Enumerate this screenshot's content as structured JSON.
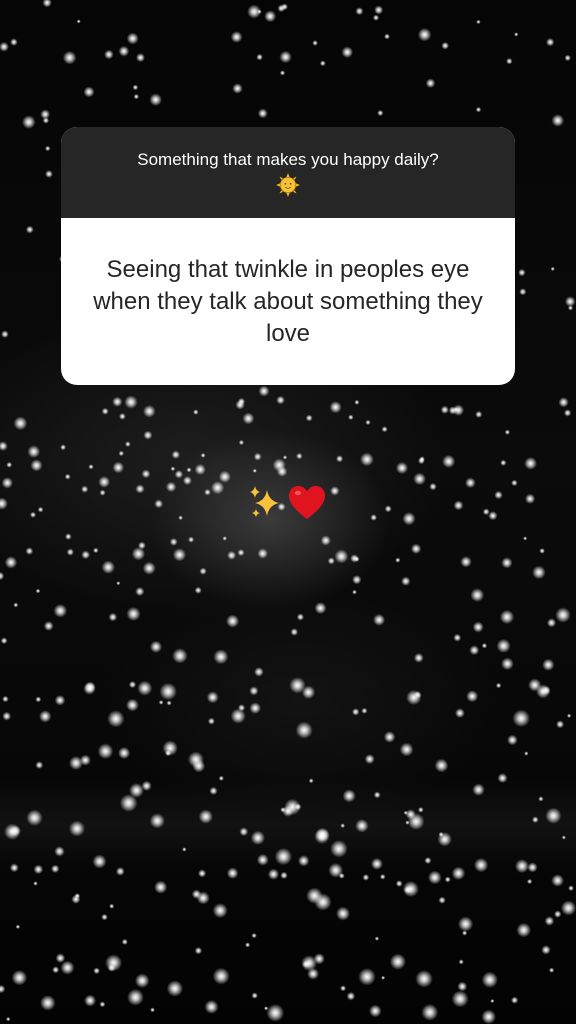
{
  "story": {
    "question": "Something that makes you happy daily?",
    "question_emoji": "sun-with-face-icon",
    "answer": "Seeing that twinkle in peoples eye when they talk about something they love",
    "sticker": [
      "sparkles-icon",
      "red-heart-icon"
    ],
    "colors": {
      "card_header": "#262626",
      "card_body": "#ffffff",
      "answer_text": "#262626",
      "background": "#000000",
      "heart": "#e0141e",
      "sparkles": "#f7c23b"
    }
  }
}
